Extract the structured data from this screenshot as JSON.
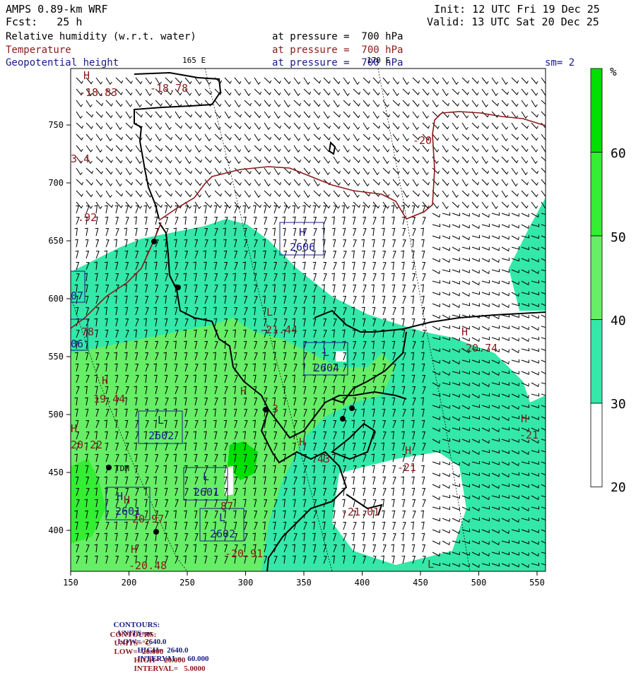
{
  "header": {
    "model": "AMPS 0.89-km WRF",
    "init": "Init: 12 UTC Fri 19 Dec 25",
    "fcst": "Fcst:   25 h",
    "valid": "Valid: 13 UTC Sat 20 Dec 25",
    "fields": [
      {
        "name": "Relative humidity (w.r.t. water)",
        "level": "at pressure =  700 hPa",
        "color": "#000000"
      },
      {
        "name": "Temperature",
        "level": "at pressure =  700 hPa",
        "color": "#8b1a1a"
      },
      {
        "name": "Geopotential height",
        "level": "at pressure =  700 hPa",
        "color": "#1a1a8b"
      }
    ],
    "lon_165": "165 E",
    "lon_170": "170 E",
    "smoothing": "sm= 2"
  },
  "map": {
    "x_ticks": [
      "150",
      "200",
      "250",
      "300",
      "350",
      "400",
      "450",
      "500",
      "550"
    ],
    "y_ticks": [
      "750",
      "700",
      "650",
      "600",
      "550",
      "500",
      "450",
      "400"
    ],
    "station_label": "TDM",
    "height_labels": [
      {
        "letter": "H",
        "value": "2606"
      },
      {
        "letter": "L",
        "value": "2604"
      },
      {
        "letter": "L",
        "value": "2602"
      },
      {
        "letter": "L",
        "value": "2601"
      },
      {
        "letter": "H",
        "value": "2601"
      },
      {
        "letter": "L",
        "value": "2602"
      },
      {
        "letter": "",
        "value": "07"
      },
      {
        "letter": "",
        "value": "06"
      }
    ],
    "temp_labels": [
      {
        "letter": "H",
        "value": "-18.83"
      },
      {
        "letter": "",
        "value": "-18.78"
      },
      {
        "letter": "",
        "value": "-20"
      },
      {
        "letter": "",
        "value": "3.4"
      },
      {
        "letter": "",
        "value": ".92"
      },
      {
        "letter": "L",
        "value": "-21.44"
      },
      {
        "letter": "H",
        "value": "-20.74"
      },
      {
        "letter": "",
        "value": "78"
      },
      {
        "letter": "H",
        "value": "19.44"
      },
      {
        "letter": "H",
        "value": "20.22"
      },
      {
        "letter": "H",
        "value": "-21"
      },
      {
        "letter": "H",
        "value": "-21"
      },
      {
        "letter": "H",
        "value": ".43"
      },
      {
        "letter": "H",
        "value": "-20.97"
      },
      {
        "letter": "",
        "value": "-20.91"
      },
      {
        "letter": "H",
        "value": "-20.48"
      },
      {
        "letter": "",
        "value": "-21.01"
      },
      {
        "letter": "",
        "value": "87"
      },
      {
        "letter": "H",
        "value": "3"
      },
      {
        "letter": "L",
        "value": ""
      }
    ]
  },
  "colorbar": {
    "unit": "%",
    "labels": [
      "60",
      "50",
      "40",
      "30",
      "20"
    ],
    "colors": [
      "#00e000",
      "#33ee33",
      "#66ee66",
      "#33e8a8",
      "#ffffff"
    ]
  },
  "footer": {
    "line1": {
      "label": "CONTOURS:",
      "units": "UNITS=m",
      "low": "LOW=  2640.0",
      "high": "HIGH=  2640.0",
      "interval": "INTERVAL=   60.000",
      "color": "#1a1a8b"
    },
    "line2": {
      "label": "CONTOURS:",
      "units": "UNITS=°C",
      "low": "LOW= -20.000",
      "high": "HIGH= -20.000",
      "interval": "INTERVAL=   5.0000",
      "color": "#8b1a1a"
    }
  }
}
